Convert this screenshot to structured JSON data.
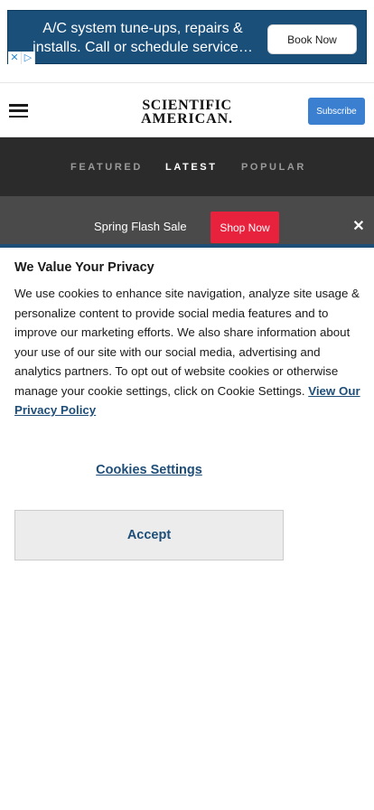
{
  "ad": {
    "line1": "A/C system tune-ups, repairs &",
    "line2": "installs. Call or schedule service…",
    "button": "Book Now",
    "close_x": "✕",
    "adchoices": "▷"
  },
  "header": {
    "logo_line1": "SCIENTIFIC",
    "logo_line2": "AMERICAN.",
    "subscribe": "Subscribe"
  },
  "tabs": [
    {
      "label": "FEATURED",
      "active": false
    },
    {
      "label": "LATEST",
      "active": true
    },
    {
      "label": "POPULAR",
      "active": false
    }
  ],
  "sale": {
    "text": "Spring Flash Sale",
    "button": "Shop Now",
    "close": "✕"
  },
  "consent": {
    "title": "We Value Your Privacy",
    "body": "We use cookies to enhance site navigation, analyze site usage & personalize content to provide social media features and to improve our marketing efforts. We also share information about your use of our site with our social media, advertising and analytics partners. To opt out of website cookies or otherwise manage your cookie settings, click on Cookie Settings.",
    "policy_link": "View Our Privacy Policy",
    "settings_button": "Cookies Settings",
    "accept_button": "Accept"
  },
  "colors": {
    "ad_bg": "#1a4f7a",
    "tabs_bg": "#2b2b2b",
    "sale_bg": "#4a4a4a",
    "sale_button": "#e8213c",
    "subscribe_bg": "#3a7fd0",
    "consent_accent": "#1e4d78"
  }
}
